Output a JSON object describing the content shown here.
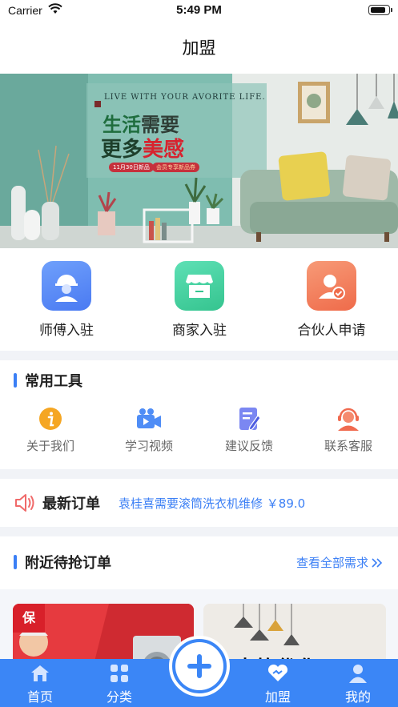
{
  "status_bar": {
    "carrier": "Carrier",
    "time": "5:49 PM",
    "battery_level": 0.9
  },
  "nav": {
    "title": "加盟"
  },
  "banner": {
    "english": "LIVE WITH YOUR AVORITE LIFE.",
    "line1_a": "生活",
    "line1_b": "需要",
    "line2_a": "更多",
    "line2_b": "美感",
    "tag1": "11月30日新品",
    "tag2": "会员专享新品券"
  },
  "join": {
    "items": [
      {
        "label": "师傅入驻",
        "icon": "worker-icon",
        "color": "#5b8ef7"
      },
      {
        "label": "商家入驻",
        "icon": "shop-icon",
        "color": "#3fcf9f"
      },
      {
        "label": "合伙人申请",
        "icon": "partner-icon",
        "color": "#f5825f"
      }
    ]
  },
  "tools": {
    "title": "常用工具",
    "items": [
      {
        "label": "关于我们",
        "icon": "info-icon",
        "color": "#f5a623"
      },
      {
        "label": "学习视频",
        "icon": "video-icon",
        "color": "#4f8df6"
      },
      {
        "label": "建议反馈",
        "icon": "feedback-icon",
        "color": "#6c7cf0"
      },
      {
        "label": "联系客服",
        "icon": "customer-service-icon",
        "color": "#f06a4f"
      }
    ]
  },
  "latest_order": {
    "title": "最新订单",
    "text": "袁桂喜需要滚筒洗衣机维修 ￥89.0"
  },
  "nearby": {
    "title": "附近待抢订单",
    "see_all": "查看全部需求",
    "promo1_badge": "保",
    "promo2_text": "大箱优化"
  },
  "tab_bar": {
    "items": [
      {
        "label": "首页",
        "icon": "home-icon"
      },
      {
        "label": "分类",
        "icon": "category-icon"
      },
      {
        "label": "加盟",
        "icon": "handshake-icon"
      },
      {
        "label": "我的",
        "icon": "profile-icon"
      }
    ]
  },
  "colors": {
    "accent": "#3b86f6",
    "link": "#3b7ff5"
  }
}
